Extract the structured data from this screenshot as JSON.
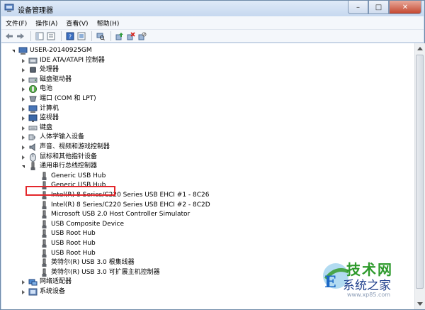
{
  "window": {
    "title": "设备管理器",
    "minimize": "–",
    "maximize": "□",
    "close": "✕"
  },
  "menu": [
    "文件(F)",
    "操作(A)",
    "查看(V)",
    "帮助(H)"
  ],
  "toolbar_icons": [
    "back-icon",
    "forward-icon",
    "sep",
    "properties-pane-icon",
    "show-hide-tree-icon",
    "sep",
    "help-icon",
    "view-icon",
    "sep",
    "scan-hardware-icon",
    "sep",
    "update-driver-icon",
    "uninstall-icon",
    "disable-icon"
  ],
  "tree": {
    "root": "USER-20140925GM",
    "categories": [
      {
        "label": "IDE ATA/ATAPI 控制器",
        "icon": "ide-controller-icon"
      },
      {
        "label": "处理器",
        "icon": "processor-icon"
      },
      {
        "label": "磁盘驱动器",
        "icon": "disk-drive-icon"
      },
      {
        "label": "电池",
        "icon": "battery-icon"
      },
      {
        "label": "端口 (COM 和 LPT)",
        "icon": "port-icon"
      },
      {
        "label": "计算机",
        "icon": "computer-icon"
      },
      {
        "label": "监视器",
        "icon": "monitor-icon"
      },
      {
        "label": "键盘",
        "icon": "keyboard-icon"
      },
      {
        "label": "人体学输入设备",
        "icon": "hid-icon"
      },
      {
        "label": "声音、视频和游戏控制器",
        "icon": "sound-icon"
      },
      {
        "label": "鼠标和其他指针设备",
        "icon": "mouse-icon"
      },
      {
        "label": "通用串行总线控制器",
        "icon": "usb-controller-icon"
      }
    ],
    "usb_children": [
      "Generic USB Hub",
      "Generic USB Hub",
      "Intel(R) 8 Series/C220 Series USB EHCI #1 - 8C26",
      "Intel(R) 8 Series/C220 Series USB EHCI #2 - 8C2D",
      "Microsoft USB 2.0 Host Controller Simulator",
      "USB Composite Device",
      "USB Root Hub",
      "USB Root Hub",
      "USB Root Hub",
      "英特尔(R) USB 3.0 根集线器",
      "英特尔(R) USB 3.0 可扩展主机控制器"
    ],
    "after": [
      {
        "label": "网络适配器",
        "icon": "network-adapter-icon"
      },
      {
        "label": "系统设备",
        "icon": "system-device-icon"
      }
    ],
    "selected": "USB Root Hub"
  },
  "watermark": {
    "line1": "技术网",
    "line2": "系统之家",
    "url": "www.xp85.com"
  },
  "colors": {
    "highlight": "#e3262b",
    "titlebar": "#c6d8ef"
  }
}
